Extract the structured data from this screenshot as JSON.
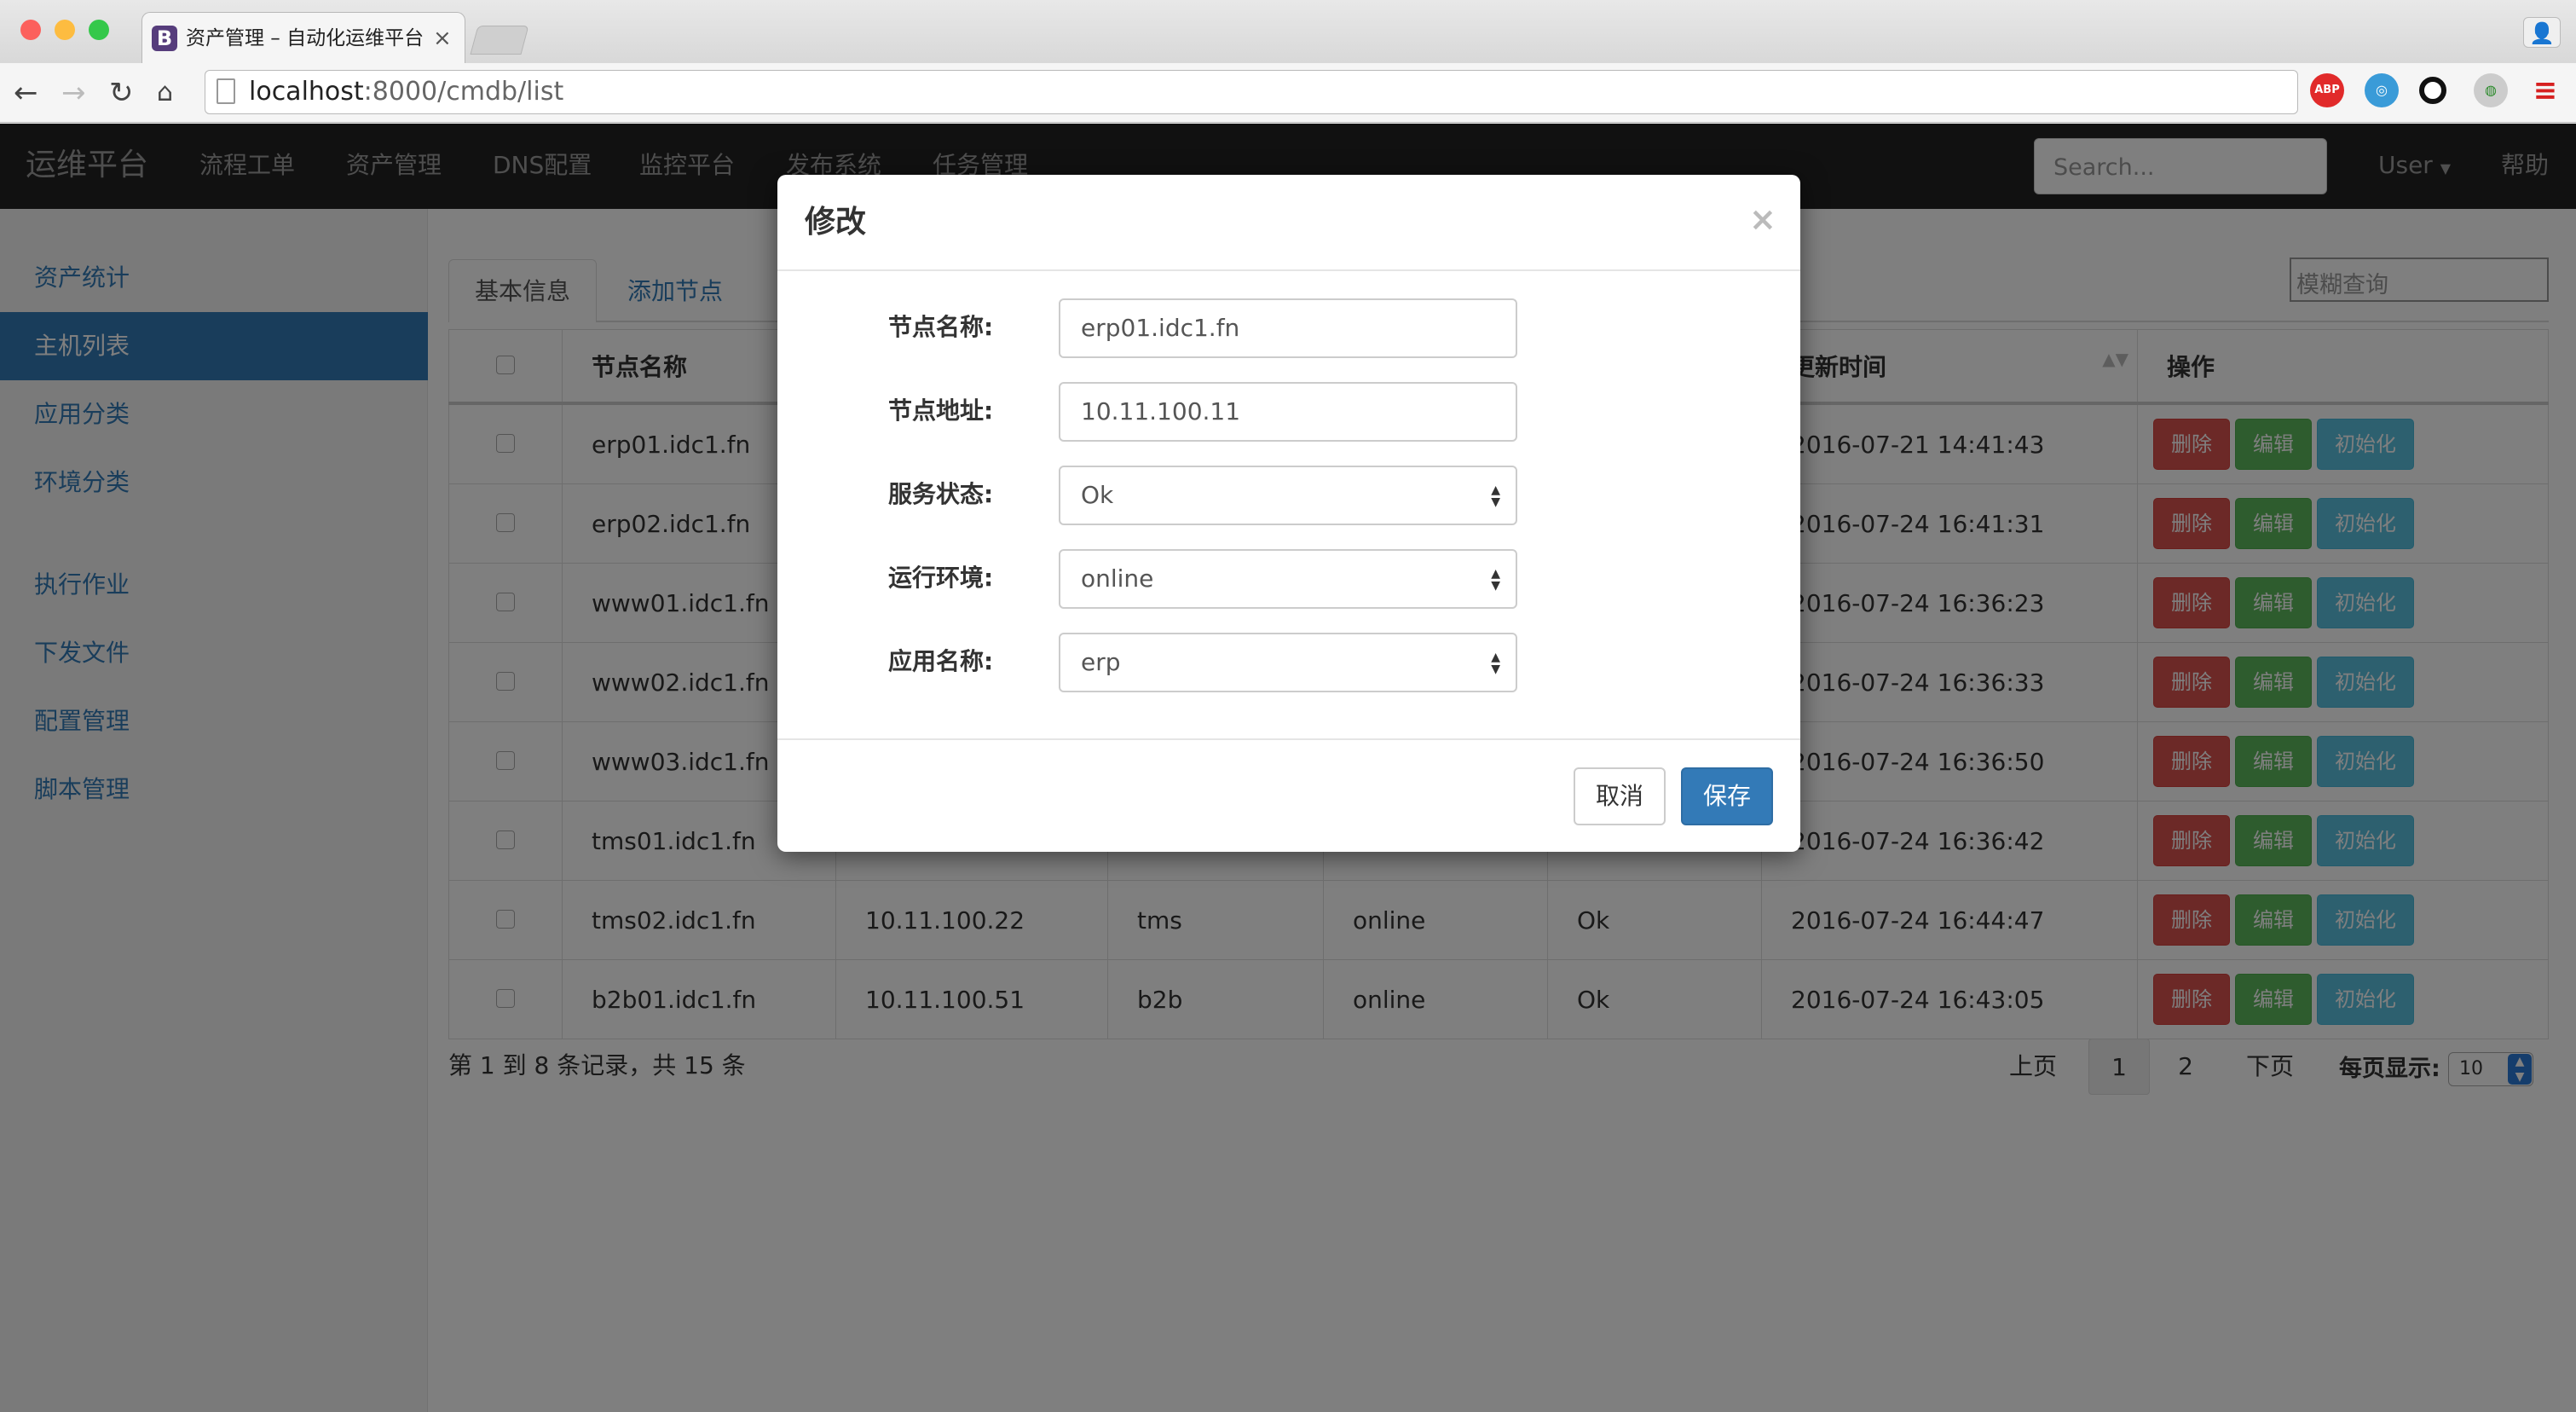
{
  "browser": {
    "tab_title": "资产管理 – 自动化运维平台",
    "tab_favicon": "B",
    "url_host": "localhost",
    "url_rest": ":8000/cmdb/list",
    "extensions": [
      "abp-icon",
      "globe-icon",
      "circle-icon",
      "extension-icon",
      "menu-icon"
    ],
    "ext_abp_label": "ABP"
  },
  "navbar": {
    "brand": "运维平台",
    "links": [
      "流程工单",
      "资产管理",
      "DNS配置",
      "监控平台",
      "发布系统",
      "任务管理"
    ],
    "search_placeholder": "Search...",
    "user": "User",
    "help": "帮助"
  },
  "sidebar": {
    "items": [
      "资产统计",
      "主机列表",
      "应用分类",
      "环境分类",
      "执行作业",
      "下发文件",
      "配置管理",
      "脚本管理"
    ],
    "active": "主机列表"
  },
  "content": {
    "tabs": [
      "基本信息",
      "添加节点"
    ],
    "fuzzy_placeholder": "模糊查询",
    "columns": [
      "节点名称",
      "",
      "",
      "",
      "",
      "更新时间",
      "操作"
    ],
    "rows": [
      {
        "name": "erp01.idc1.fn",
        "ip": "",
        "app": "",
        "env": "",
        "status": "",
        "time": "2016-07-21 14:41:43"
      },
      {
        "name": "erp02.idc1.fn",
        "ip": "",
        "app": "",
        "env": "",
        "status": "",
        "time": "2016-07-24 16:41:31"
      },
      {
        "name": "www01.idc1.fn",
        "ip": "",
        "app": "",
        "env": "",
        "status": "",
        "time": "2016-07-24 16:36:23"
      },
      {
        "name": "www02.idc1.fn",
        "ip": "",
        "app": "",
        "env": "",
        "status": "",
        "time": "2016-07-24 16:36:33"
      },
      {
        "name": "www03.idc1.fn",
        "ip": "",
        "app": "",
        "env": "",
        "status": "",
        "time": "2016-07-24 16:36:50"
      },
      {
        "name": "tms01.idc1.fn",
        "ip": "",
        "app": "",
        "env": "",
        "status": "",
        "time": "2016-07-24 16:36:42"
      },
      {
        "name": "tms02.idc1.fn",
        "ip": "10.11.100.22",
        "app": "tms",
        "env": "online",
        "status": "Ok",
        "time": "2016-07-24 16:44:47"
      },
      {
        "name": "b2b01.idc1.fn",
        "ip": "10.11.100.51",
        "app": "b2b",
        "env": "online",
        "status": "Ok",
        "time": "2016-07-24 16:43:05"
      }
    ],
    "actions": {
      "delete": "删除",
      "edit": "编辑",
      "init": "初始化"
    },
    "footer_info": "第 1 到 8 条记录，共 15 条",
    "pagination": {
      "prev": "上页",
      "pages": [
        "1",
        "2"
      ],
      "next": "下页",
      "per_page_label": "每页显示:",
      "per_page_value": "10"
    }
  },
  "modal": {
    "title": "修改",
    "close": "×",
    "fields": [
      {
        "label": "节点名称:",
        "value": "erp01.idc1.fn",
        "type": "text"
      },
      {
        "label": "节点地址:",
        "value": "10.11.100.11",
        "type": "text"
      },
      {
        "label": "服务状态:",
        "value": "Ok",
        "type": "select"
      },
      {
        "label": "运行环境:",
        "value": "online",
        "type": "select"
      },
      {
        "label": "应用名称:",
        "value": "erp",
        "type": "select"
      }
    ],
    "cancel": "取消",
    "save": "保存"
  },
  "colors": {
    "primary": "#337ab7",
    "danger": "#d9534f",
    "success": "#5cb85c",
    "info": "#5bc0de",
    "navbar": "#222222"
  }
}
